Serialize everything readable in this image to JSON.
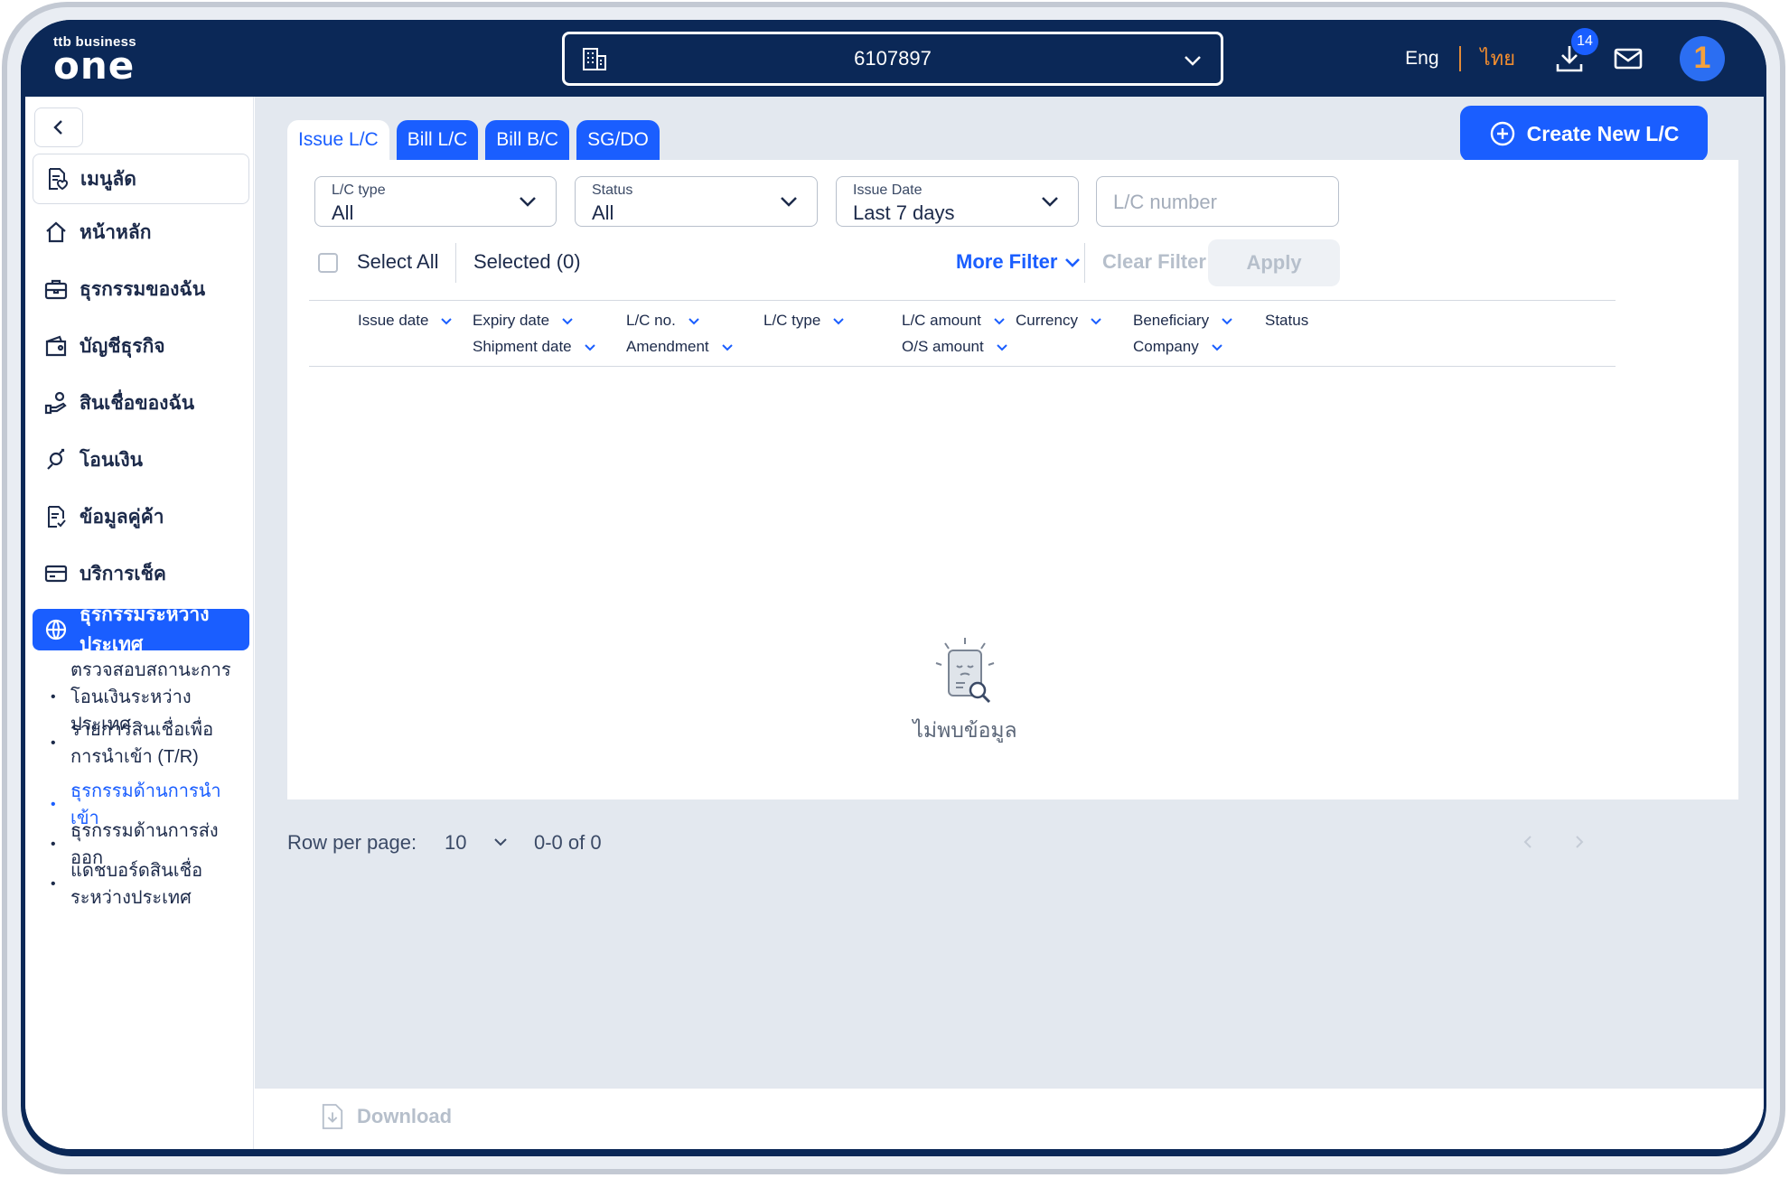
{
  "header": {
    "logo_top": "ttb business",
    "logo_main": "one",
    "account_number": "6107897",
    "lang_eng": "Eng",
    "lang_thai": "ไทย",
    "download_badge": "14",
    "avatar_text": "1"
  },
  "sidebar": {
    "items": [
      {
        "label": "เมนูลัด"
      },
      {
        "label": "หน้าหลัก"
      },
      {
        "label": "ธุรกรรมของฉัน"
      },
      {
        "label": "บัญชีธุรกิจ"
      },
      {
        "label": "สินเชื่อของฉัน"
      },
      {
        "label": "โอนเงิน"
      },
      {
        "label": "ข้อมูลคู่ค้า"
      },
      {
        "label": "บริการเช็ค"
      },
      {
        "label": "ธุรกรรมระหว่างประเทศ"
      }
    ],
    "sub_items": [
      {
        "label": "ตรวจสอบสถานะการโอนเงินระหว่างประเทศ"
      },
      {
        "label": "รายการสินเชื่อเพื่อการนำเข้า (T/R)"
      },
      {
        "label": "ธุรกรรมด้านการนำเข้า"
      },
      {
        "label": "ธุรกรรมด้านการส่งออก"
      },
      {
        "label": "แดชบอร์ดสินเชื่อ ระหว่างประเทศ"
      }
    ]
  },
  "tabs": [
    {
      "label": "Issue L/C"
    },
    {
      "label": "Bill L/C"
    },
    {
      "label": "Bill B/C"
    },
    {
      "label": "SG/DO"
    }
  ],
  "create_button": "Create New L/C",
  "filters": {
    "lc_type": {
      "label": "L/C type",
      "value": "All"
    },
    "status": {
      "label": "Status",
      "value": "All"
    },
    "issue_date": {
      "label": "Issue Date",
      "value": "Last 7 days"
    },
    "lc_number": {
      "placeholder": "L/C number"
    }
  },
  "selection": {
    "select_all": "Select All",
    "selected": "Selected (0)",
    "more_filter": "More Filter",
    "clear_filter": "Clear Filter",
    "apply": "Apply"
  },
  "columns": {
    "issue_date": "Issue date",
    "expiry_date": "Expiry date",
    "shipment_date": "Shipment date",
    "lc_no": "L/C no.",
    "amendment": "Amendment",
    "lc_type": "L/C type",
    "lc_amount": "L/C amount",
    "os_amount": "O/S amount",
    "currency": "Currency",
    "beneficiary": "Beneficiary",
    "company": "Company",
    "status": "Status"
  },
  "empty_state": "ไม่พบข้อมูล",
  "pagination": {
    "row_per_page_label": "Row per page:",
    "rows": "10",
    "range": "0-0 of 0"
  },
  "footer": {
    "download": "Download"
  },
  "colors": {
    "brand_navy": "#0b2857",
    "accent_blue": "#1a5eff",
    "thai_orange": "#f08c2f"
  }
}
